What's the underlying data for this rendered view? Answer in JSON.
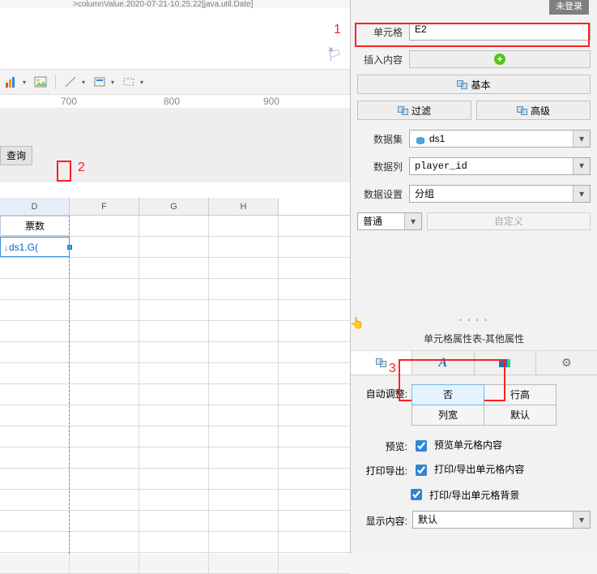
{
  "top": {
    "status_fragment": ">columnValue.2020-07-21-10.25.22[java.util.Date]",
    "login_badge": "未登录"
  },
  "ruler": {
    "m700": "700",
    "m800": "800",
    "m900": "900"
  },
  "left": {
    "query_btn": "查询",
    "columns": {
      "D": "D",
      "F": "F",
      "G": "G",
      "H": "H"
    },
    "header_cell": "票数",
    "data_cell": "ds1.G("
  },
  "annotations": {
    "a1": "1",
    "a2": "2",
    "a3": "3"
  },
  "rp": {
    "cell_label": "单元格",
    "cell_value": "E2",
    "insert_label": "插入内容",
    "basic_btn": "基本",
    "filter_btn": "过滤",
    "advanced_btn": "高级",
    "dataset_label": "数据集",
    "dataset_value": "ds1",
    "datacol_label": "数据列",
    "datacol_value": "player_id",
    "datasetting_label": "数据设置",
    "datasetting_value": "分组",
    "mode_value": "普通",
    "custom_btn": "自定义"
  },
  "panel2": {
    "title": "单元格属性表-其他属性",
    "autoadjust_label": "自动调整",
    "opts": {
      "no": "否",
      "rowh": "行高",
      "colw": "列宽",
      "default": "默认"
    },
    "preview_label": "预览",
    "preview_chk": "预览单元格内容",
    "printexport_label": "打印导出",
    "print_content": "打印/导出单元格内容",
    "print_bg": "打印/导出单元格背景",
    "display_label": "显示内容",
    "display_value": "默认"
  }
}
